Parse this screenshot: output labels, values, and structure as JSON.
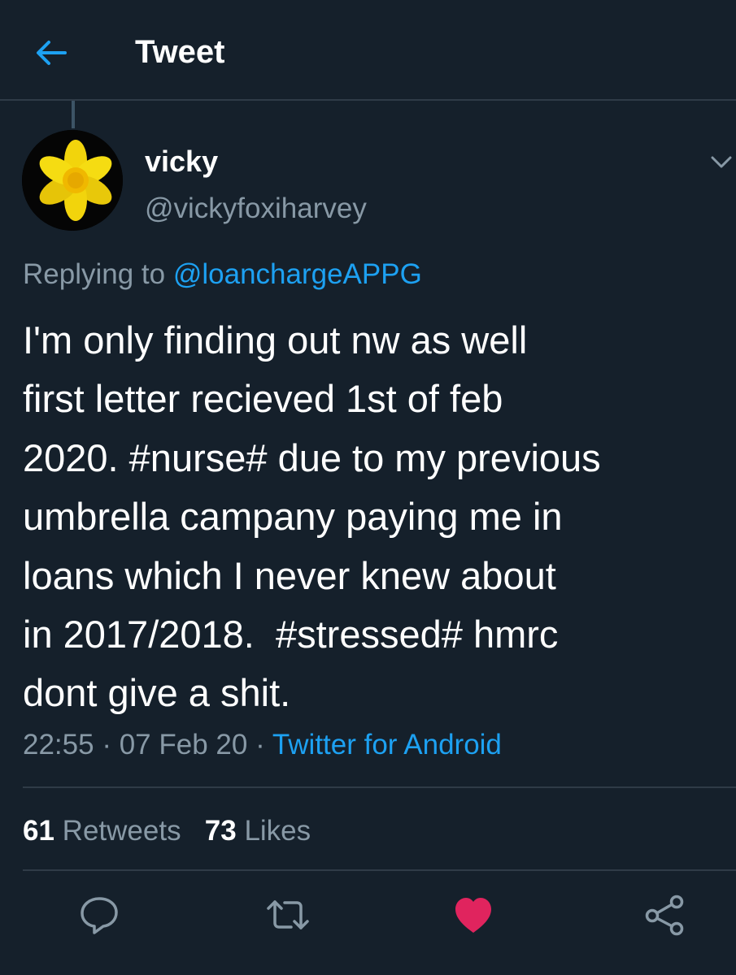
{
  "header": {
    "title": "Tweet"
  },
  "tweet": {
    "display_name": "vicky",
    "handle": "@vickyfoxiharvey",
    "replying_prefix": "Replying to",
    "replying_to": "@loanchargeAPPG",
    "text_lines": [
      "I'm only finding out nw as well",
      "first letter recieved 1st of feb",
      "2020. #nurse# due to my previous",
      "umbrella campany paying me in",
      "loans which I never knew about",
      "in 2017/2018.  #stressed# hmrc",
      "dont give a shit."
    ],
    "time": "22:55",
    "separator": "·",
    "date": "07 Feb 20",
    "source": "Twitter for Android"
  },
  "stats": {
    "retweets_count": "61",
    "retweets_label": "Retweets",
    "likes_count": "73",
    "likes_label": "Likes"
  },
  "actions": {
    "reply_icon": "reply-icon",
    "retweet_icon": "retweet-icon",
    "like_icon": "heart-icon",
    "like_state": "liked",
    "share_icon": "share-icon"
  },
  "colors": {
    "background": "#15202b",
    "accent": "#1da1f2",
    "muted": "#8899a6",
    "like": "#e0245e",
    "divider": "#2f3b47"
  }
}
